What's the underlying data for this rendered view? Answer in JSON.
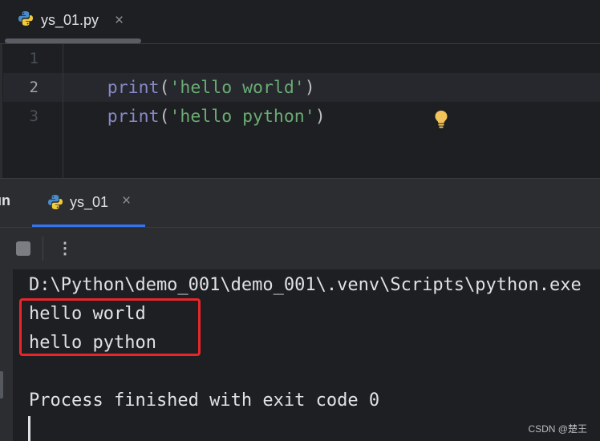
{
  "editor": {
    "tab": {
      "filename": "ys_01.py",
      "close_symbol": "×",
      "icon": "python-icon"
    },
    "line_numbers": [
      "1",
      "2",
      "3"
    ],
    "current_line": 2,
    "lines": [
      {
        "fn": "print",
        "open": "(",
        "str": "'hello world'",
        "close": ")"
      },
      {
        "fn": "print",
        "open": "(",
        "str": "'hello python'",
        "close": ")"
      }
    ],
    "intention_icon": "lightbulb-icon"
  },
  "run_window": {
    "label": "Run",
    "tab": {
      "label": "ys_01",
      "close_symbol": "×",
      "icon": "python-icon"
    },
    "toolbar": {
      "stop_icon": "stop-icon",
      "more_symbol": "⋮"
    },
    "console": {
      "command": "D:\\Python\\demo_001\\demo_001\\.venv\\Scripts\\python.exe",
      "output": [
        "hello world",
        "hello python"
      ],
      "blank": "",
      "exit_message": "Process finished with exit code 0"
    }
  },
  "watermark": "CSDN @楚王",
  "colors": {
    "editor_bg": "#1e1f22",
    "panel_bg": "#2b2d30",
    "function": "#8888c6",
    "string": "#6aab73",
    "accent_tab": "#3574f0",
    "highlight_box": "#e8262a"
  }
}
